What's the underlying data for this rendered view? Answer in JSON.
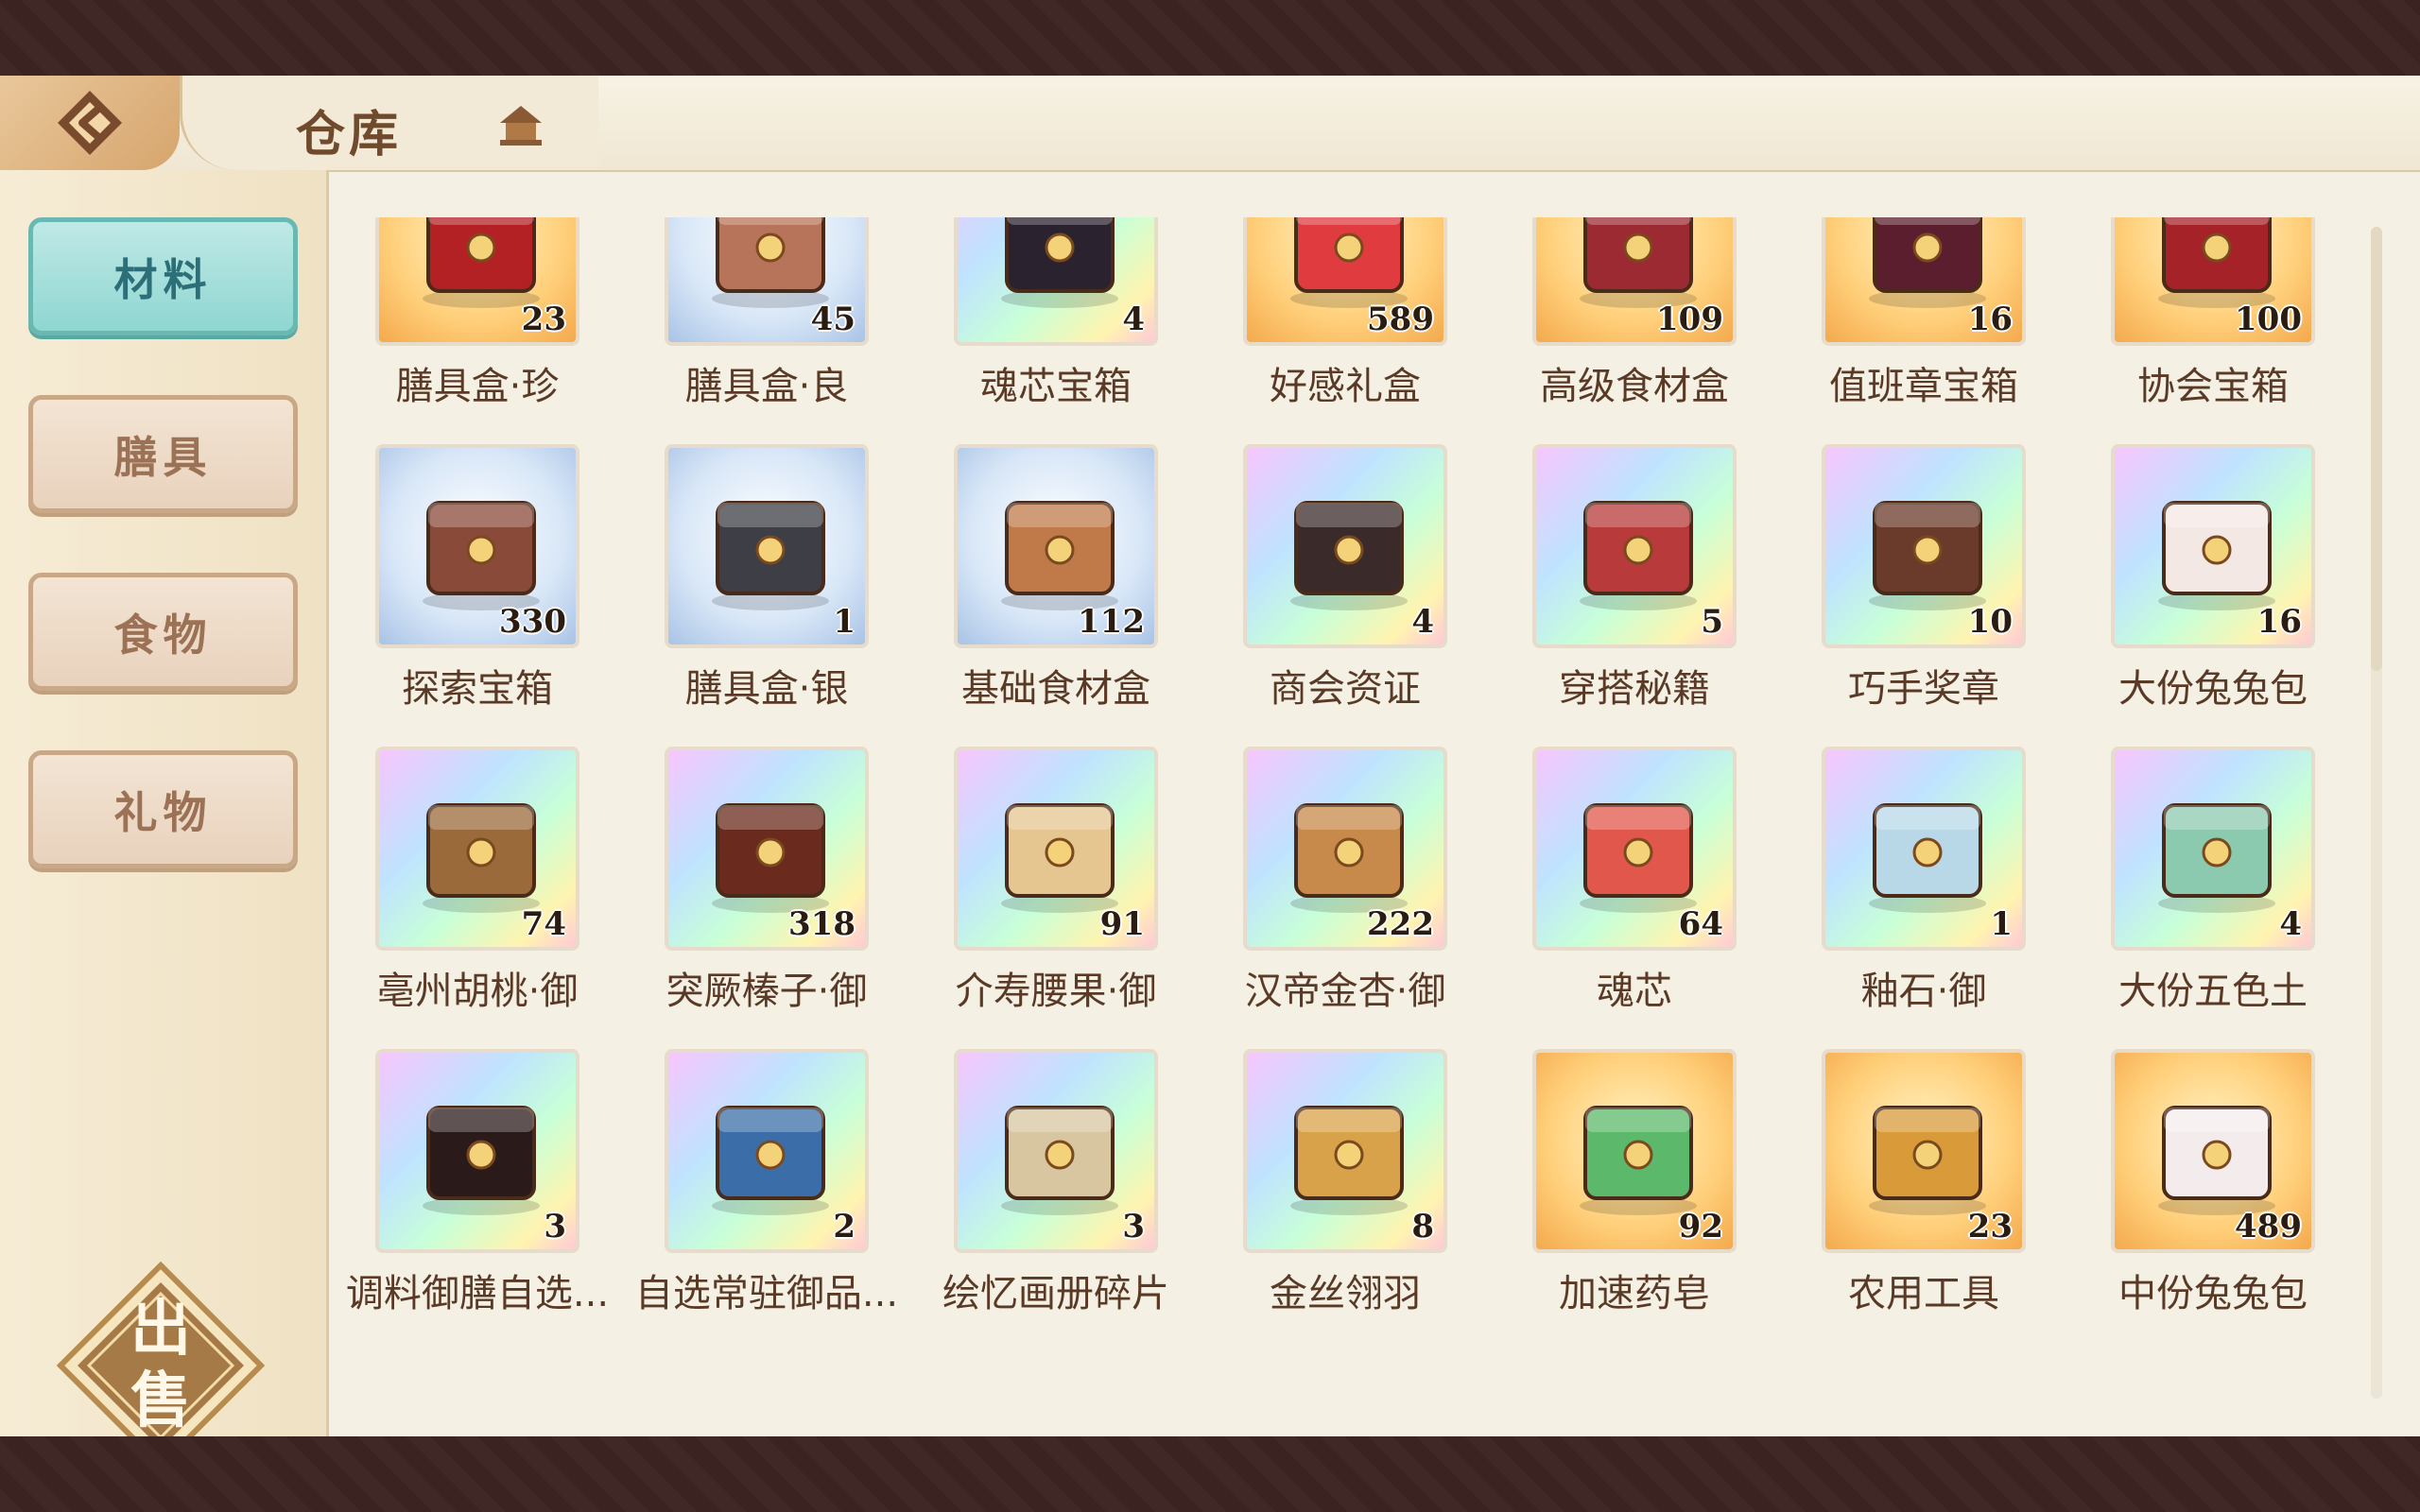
{
  "header": {
    "title": "仓库"
  },
  "sidebar": {
    "tabs": [
      {
        "label": "材料",
        "active": true
      },
      {
        "label": "膳具",
        "active": false
      },
      {
        "label": "食物",
        "active": false
      },
      {
        "label": "礼物",
        "active": false
      }
    ],
    "sell_button": {
      "line1": "出",
      "line2": "售"
    }
  },
  "items": [
    {
      "name": "膳具盒·珍",
      "count": "23",
      "bg": "gold",
      "icon": "red-box-icon",
      "color": "#b32124"
    },
    {
      "name": "膳具盒·良",
      "count": "45",
      "bg": "blue",
      "icon": "wood-box-icon",
      "color": "#b8745a"
    },
    {
      "name": "魂芯宝箱",
      "count": "4",
      "bg": "rainbow",
      "icon": "basket-icon",
      "color": "#2b2230"
    },
    {
      "name": "好感礼盒",
      "count": "589",
      "bg": "gold",
      "icon": "gift-icon",
      "color": "#e03b3f"
    },
    {
      "name": "高级食材盒",
      "count": "109",
      "bg": "gold",
      "icon": "food-box-icon",
      "color": "#9c2a33"
    },
    {
      "name": "值班章宝箱",
      "count": "16",
      "bg": "gold",
      "icon": "chest-icon",
      "color": "#5a1e2e"
    },
    {
      "name": "协会宝箱",
      "count": "100",
      "bg": "gold",
      "icon": "red-chest-icon",
      "color": "#a42228"
    },
    {
      "name": "探索宝箱",
      "count": "330",
      "bg": "blue",
      "icon": "treasure-chest-icon",
      "color": "#8a4a3a"
    },
    {
      "name": "膳具盒·银",
      "count": "1",
      "bg": "blue",
      "icon": "silver-box-icon",
      "color": "#3d3e46"
    },
    {
      "name": "基础食材盒",
      "count": "112",
      "bg": "blue",
      "icon": "basket-box-icon",
      "color": "#c07a4a"
    },
    {
      "name": "商会资证",
      "count": "4",
      "bg": "rainbow",
      "icon": "card-icon",
      "color": "#3a2a2a"
    },
    {
      "name": "穿搭秘籍",
      "count": "5",
      "bg": "rainbow",
      "icon": "book-icon",
      "color": "#b93a3a"
    },
    {
      "name": "巧手奖章",
      "count": "10",
      "bg": "rainbow",
      "icon": "medal-icon",
      "color": "#6a3a2a"
    },
    {
      "name": "大份兔兔包",
      "count": "16",
      "bg": "rainbow",
      "icon": "bun-icon",
      "color": "#f4e8e4"
    },
    {
      "name": "亳州胡桃·御",
      "count": "74",
      "bg": "rainbow",
      "icon": "walnut-icon",
      "color": "#9b6a3a"
    },
    {
      "name": "突厥榛子·御",
      "count": "318",
      "bg": "rainbow",
      "icon": "hazelnut-icon",
      "color": "#6a2a1e"
    },
    {
      "name": "介寿腰果·御",
      "count": "91",
      "bg": "rainbow",
      "icon": "cashew-icon",
      "color": "#e5c690"
    },
    {
      "name": "汉帝金杏·御",
      "count": "222",
      "bg": "rainbow",
      "icon": "almond-icon",
      "color": "#c78a4a"
    },
    {
      "name": "魂芯",
      "count": "64",
      "bg": "rainbow",
      "icon": "soul-flame-icon",
      "color": "#e2574c"
    },
    {
      "name": "釉石·御",
      "count": "1",
      "bg": "rainbow",
      "icon": "glaze-stone-icon",
      "color": "#b8d8e8"
    },
    {
      "name": "大份五色土",
      "count": "4",
      "bg": "rainbow",
      "icon": "soil-icon",
      "color": "#8ccab0"
    },
    {
      "name": "调料御膳自选...",
      "count": "3",
      "bg": "rainbow",
      "icon": "lacquer-box-icon",
      "color": "#2a1a1a"
    },
    {
      "name": "自选常驻御品...",
      "count": "2",
      "bg": "rainbow",
      "icon": "mystery-icon",
      "color": "#3b6ea8"
    },
    {
      "name": "绘忆画册碎片",
      "count": "3",
      "bg": "rainbow",
      "icon": "puzzle-book-icon",
      "color": "#d8c6a0"
    },
    {
      "name": "金丝翎羽",
      "count": "8",
      "bg": "rainbow",
      "icon": "feather-icon",
      "color": "#d8a24a"
    },
    {
      "name": "加速药皂",
      "count": "92",
      "bg": "gold",
      "icon": "soap-icon",
      "color": "#5cb86a"
    },
    {
      "name": "农用工具",
      "count": "23",
      "bg": "gold",
      "icon": "toolbox-icon",
      "color": "#d99a3a"
    },
    {
      "name": "中份兔兔包",
      "count": "489",
      "bg": "gold",
      "icon": "bun-plate-icon",
      "color": "#f4ecec"
    }
  ]
}
